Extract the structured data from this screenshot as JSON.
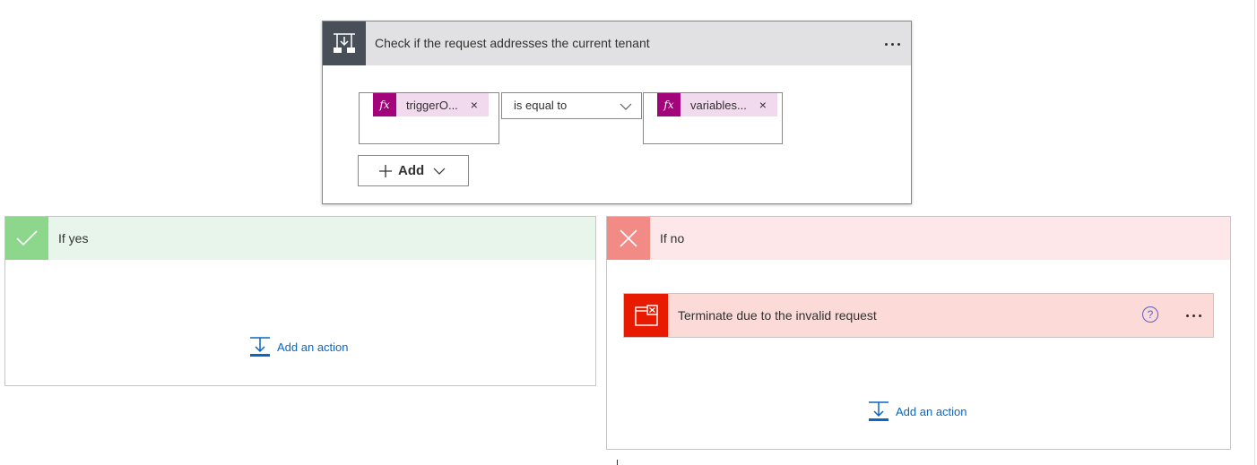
{
  "condition": {
    "title": "Check if the request addresses the current tenant",
    "left_token": "triggerO...",
    "operator": "is equal to",
    "right_token": "variables...",
    "fx_symbol": "fx",
    "remove_symbol": "×",
    "add_label": "Add",
    "icon": "condition-icon"
  },
  "branches": {
    "yes": {
      "title": "If yes",
      "add_action_label": "Add an action",
      "icon": "checkmark-icon",
      "color": "#8cd78c"
    },
    "no": {
      "title": "If no",
      "add_action_label": "Add an action",
      "icon": "close-icon",
      "color": "#f28b85",
      "action": {
        "title": "Terminate due to the invalid request",
        "icon": "terminate-icon",
        "help_symbol": "?",
        "color": "#e81b00"
      }
    }
  },
  "colors": {
    "token": "#a4047b",
    "token_bg": "#f1d9ee",
    "link": "#0a66c2",
    "condition_icon_bg": "#484f58"
  }
}
